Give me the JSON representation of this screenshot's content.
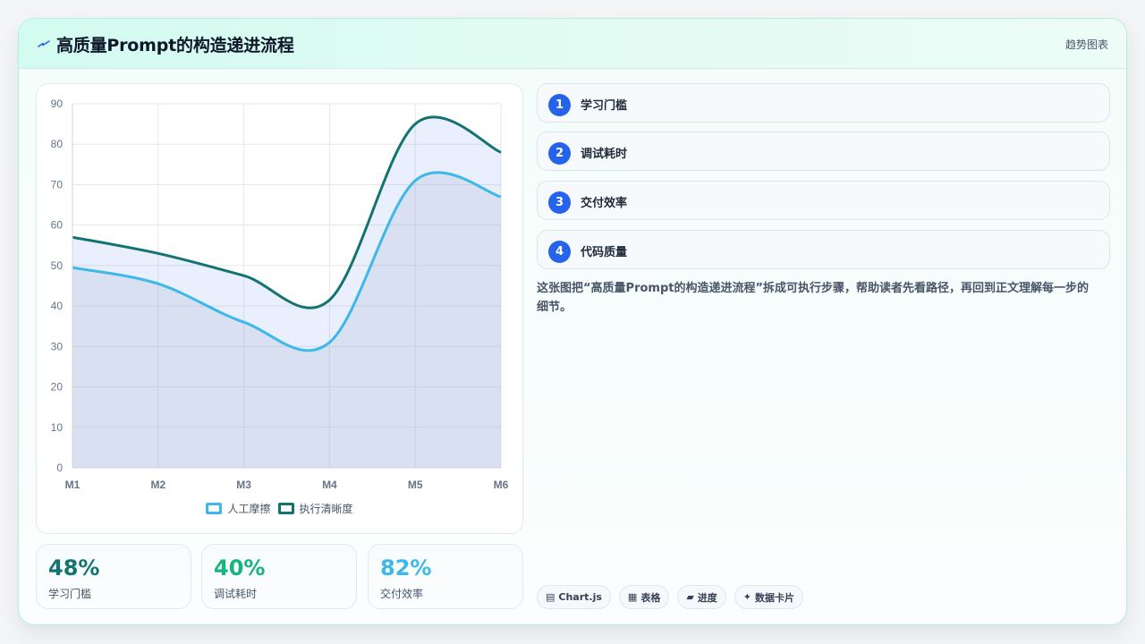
{
  "header": {
    "title": "高质量Prompt的构造递进流程",
    "tag": "趋势图表"
  },
  "colors": {
    "series_1": "#3db8e8",
    "series_2": "#137370",
    "accent": "#2563eb",
    "stat_1": "#137370",
    "stat_2": "#17b47e",
    "stat_3": "#3db8e8"
  },
  "chart_data": {
    "type": "line",
    "categories": [
      "M1",
      "M2",
      "M3",
      "M4",
      "M5",
      "M6"
    ],
    "series": [
      {
        "name": "人工摩擦",
        "values": [
          49.5,
          45.5,
          36,
          31,
          71,
          67
        ],
        "fill": "area"
      },
      {
        "name": "执行清晰度",
        "values": [
          57,
          53,
          47.5,
          41.5,
          85,
          78
        ],
        "fill": "area"
      }
    ],
    "y_ticks": [
      "0",
      "10",
      "20",
      "30",
      "40",
      "50",
      "60",
      "70",
      "80",
      "90"
    ],
    "ylim": [
      0,
      90
    ],
    "grid": true,
    "legend": "bottom",
    "curve": "smooth"
  },
  "stats": [
    {
      "value": "48%",
      "label": "学习门槛"
    },
    {
      "value": "40%",
      "label": "调试耗时"
    },
    {
      "value": "82%",
      "label": "交付效率"
    }
  ],
  "steps": [
    {
      "num": "1",
      "label": "学习门槛"
    },
    {
      "num": "2",
      "label": "调试耗时"
    },
    {
      "num": "3",
      "label": "交付效率"
    },
    {
      "num": "4",
      "label": "代码质量"
    }
  ],
  "description": "这张图把“高质量Prompt的构造递进流程”拆成可执行步骤，帮助读者先看路径，再回到正文理解每一步的细节。",
  "tags": [
    {
      "icon": "▤",
      "label": "Chart.js"
    },
    {
      "icon": "▦",
      "label": "表格"
    },
    {
      "icon": "▰",
      "label": "进度"
    },
    {
      "icon": "✦",
      "label": "数据卡片"
    }
  ]
}
